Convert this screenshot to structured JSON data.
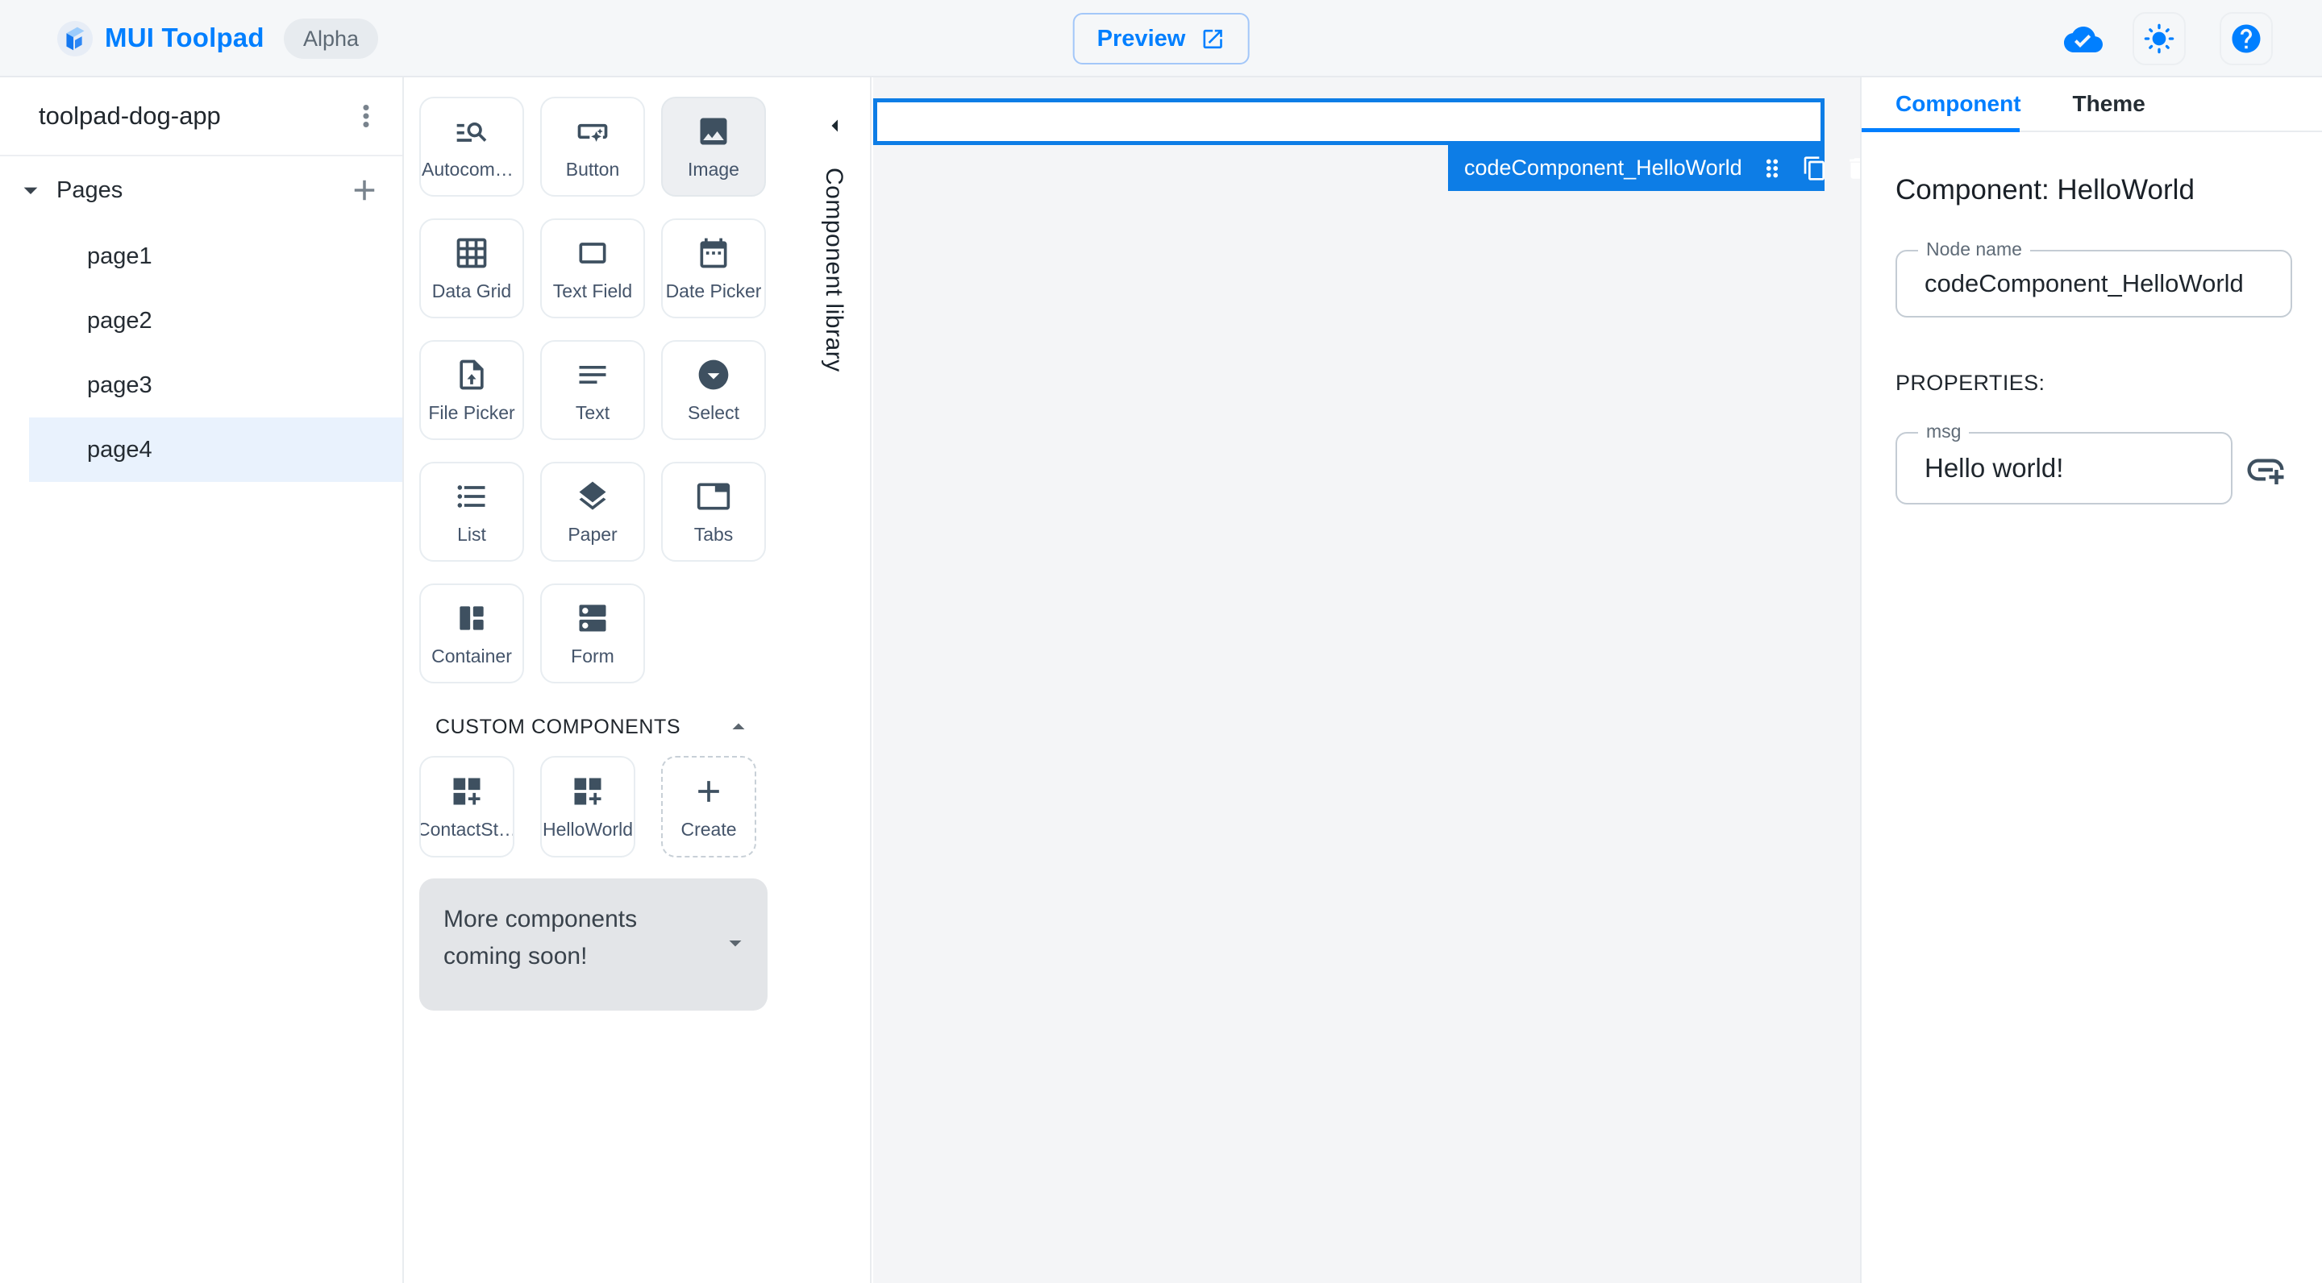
{
  "header": {
    "app_title": "MUI Toolpad",
    "version_badge": "Alpha",
    "preview_label": "Preview",
    "icons": [
      "toolpad-logo-icon",
      "open-in-new-icon",
      "cloud-done-icon",
      "light-mode-icon",
      "help-icon"
    ]
  },
  "sidebar": {
    "project_name": "toolpad-dog-app",
    "pages_section_label": "Pages",
    "pages": [
      {
        "label": "page1",
        "selected": false
      },
      {
        "label": "page2",
        "selected": false
      },
      {
        "label": "page3",
        "selected": false
      },
      {
        "label": "page4",
        "selected": true
      }
    ]
  },
  "library": {
    "panel_label": "Component library",
    "components": [
      {
        "label": "Autocomplete",
        "icon": "manage-search-icon"
      },
      {
        "label": "Button",
        "icon": "smart-button-icon"
      },
      {
        "label": "Image",
        "icon": "image-icon",
        "state": "highlighted"
      },
      {
        "label": "Data Grid",
        "icon": "grid-on-icon"
      },
      {
        "label": "Text Field",
        "icon": "rectangle-outline-icon"
      },
      {
        "label": "Date Picker",
        "icon": "calendar-icon"
      },
      {
        "label": "File Picker",
        "icon": "upload-file-icon"
      },
      {
        "label": "Text",
        "icon": "text-lines-icon"
      },
      {
        "label": "Select",
        "icon": "dropdown-circle-icon"
      },
      {
        "label": "List",
        "icon": "bulleted-list-icon"
      },
      {
        "label": "Paper",
        "icon": "layers-icon"
      },
      {
        "label": "Tabs",
        "icon": "tab-icon"
      },
      {
        "label": "Container",
        "icon": "container-columns-icon"
      },
      {
        "label": "Form",
        "icon": "stacked-rows-icon"
      }
    ],
    "custom_section_label": "CUSTOM COMPONENTS",
    "custom_components": [
      {
        "label": "ContactSta…",
        "icon": "dashboard-customize-icon"
      },
      {
        "label": "HelloWorld",
        "icon": "dashboard-customize-icon"
      },
      {
        "label": "Create",
        "icon": "plus-icon"
      }
    ],
    "coming_soon_text": "More components coming soon!"
  },
  "canvas": {
    "selected_node_label": "codeComponent_HelloWorld",
    "selection_icons": [
      "drag-handle-icon",
      "copy-icon",
      "trash-icon"
    ]
  },
  "inspector": {
    "tabs": [
      {
        "label": "Component",
        "active": true
      },
      {
        "label": "Theme",
        "active": false
      }
    ],
    "heading": "Component: HelloWorld",
    "node_name": {
      "label": "Node name",
      "value": "codeComponent_HelloWorld"
    },
    "properties_label": "PROPERTIES:",
    "properties": [
      {
        "label": "msg",
        "value": "Hello world!"
      }
    ]
  },
  "colors": {
    "accent": "#007FFF",
    "selection_blue": "#0d7de6",
    "icon_slate": "#3E5060",
    "canvas_bg": "#f4f5f7",
    "selected_row_bg": "#e9f2fd",
    "header_bg": "#f5f7f9"
  }
}
